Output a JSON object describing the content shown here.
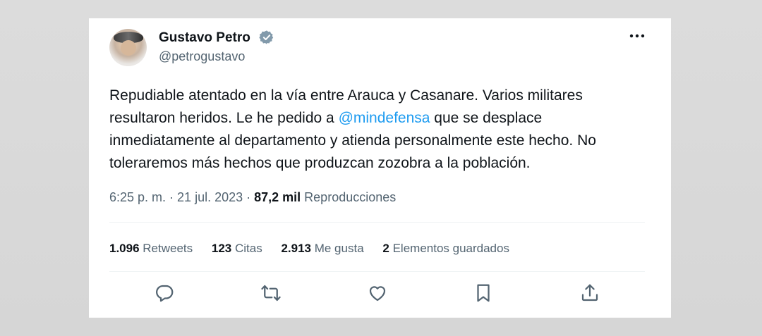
{
  "author": {
    "name": "Gustavo Petro",
    "handle": "@petrogustavo",
    "avatar_icon": "avatar-photo",
    "verified_color": "#829aab"
  },
  "tweet": {
    "text_before": "Repudiable atentado en la vía entre Arauca y Casanare. Varios militares resultaron heridos. Le he pedido a ",
    "mention": "@mindefensa",
    "text_after": " que se desplace inmediatamente al departamento y atienda personalmente este hecho. No toleraremos más hechos que produzcan zozobra a la población."
  },
  "meta": {
    "time": "6:25 p. m.",
    "sep1": " · ",
    "date": "21 jul. 2023",
    "sep2": " · ",
    "views_count": "87,2 mil",
    "views_label": " Reproducciones"
  },
  "stats": {
    "retweets_count": "1.096",
    "retweets_label": " Retweets",
    "quotes_count": "123",
    "quotes_label": " Citas",
    "likes_count": "2.913",
    "likes_label": " Me gusta",
    "bookmarks_count": "2",
    "bookmarks_label": " Elementos guardados"
  },
  "actions": [
    "reply-icon",
    "retweet-icon",
    "like-icon",
    "bookmark-icon",
    "share-icon"
  ],
  "colors": {
    "text": "#0f1419",
    "secondary": "#536471",
    "link": "#1d9bf0",
    "divider": "#eff3f4"
  }
}
